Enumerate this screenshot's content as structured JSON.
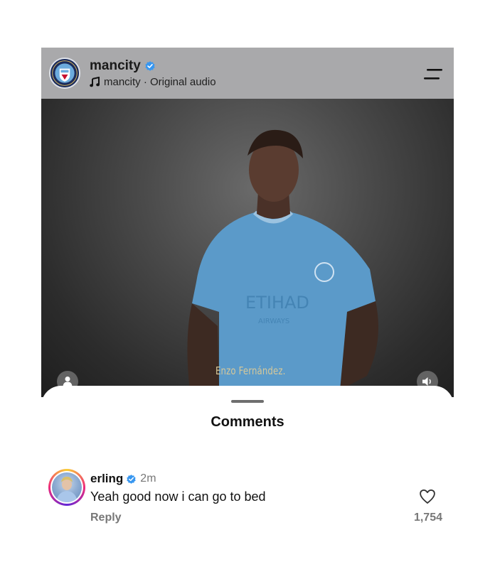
{
  "header": {
    "account_name": "mancity",
    "audio_line": "mancity · Original audio",
    "brand_color": "#1c2c5b",
    "verified_color": "#3897f0"
  },
  "video": {
    "caption": "Enzo Fernández."
  },
  "comments_sheet": {
    "title": "Comments",
    "comments": [
      {
        "username": "erling",
        "time": "2m",
        "text": "Yeah good now i can go to bed",
        "reply_label": "Reply",
        "like_count": "1,754"
      }
    ]
  },
  "icons": {
    "menu": "menu-icon",
    "music": "music-note-icon",
    "verified": "verified-badge-icon",
    "like": "heart-icon",
    "user": "user-icon",
    "audio": "speaker-icon"
  }
}
